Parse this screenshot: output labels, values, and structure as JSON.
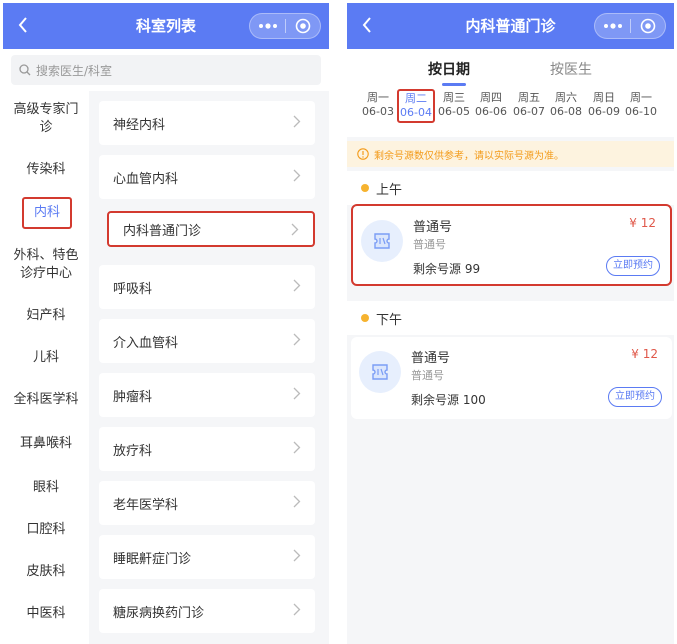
{
  "left": {
    "title": "科室列表",
    "search_placeholder": "搜索医生/科室",
    "departments": [
      {
        "label": "高级专家门诊"
      },
      {
        "label": "传染科"
      },
      {
        "label": "内科"
      },
      {
        "label": "外科、特色诊疗中心"
      },
      {
        "label": "妇产科"
      },
      {
        "label": "儿科"
      },
      {
        "label": "全科医学科"
      },
      {
        "label": "耳鼻喉科"
      },
      {
        "label": "眼科"
      },
      {
        "label": "口腔科"
      },
      {
        "label": "皮肤科"
      },
      {
        "label": "中医科"
      }
    ],
    "active_department": "内科",
    "sub_departments": [
      {
        "label": "神经内科"
      },
      {
        "label": "心血管内科"
      },
      {
        "label": "内科普通门诊"
      },
      {
        "label": "呼吸科"
      },
      {
        "label": "介入血管科"
      },
      {
        "label": "肿瘤科"
      },
      {
        "label": "放疗科"
      },
      {
        "label": "老年医学科"
      },
      {
        "label": "睡眠鼾症门诊"
      },
      {
        "label": "糖尿病换药门诊"
      }
    ]
  },
  "right": {
    "title": "内科普通门诊",
    "tabs": [
      {
        "label": "按日期",
        "active": true
      },
      {
        "label": "按医生",
        "active": false
      }
    ],
    "dates": [
      {
        "weekday": "周一",
        "date": "06-03"
      },
      {
        "weekday": "周二",
        "date": "06-04"
      },
      {
        "weekday": "周三",
        "date": "06-05"
      },
      {
        "weekday": "周四",
        "date": "06-06"
      },
      {
        "weekday": "周五",
        "date": "06-07"
      },
      {
        "weekday": "周六",
        "date": "06-08"
      },
      {
        "weekday": "周日",
        "date": "06-09"
      },
      {
        "weekday": "周一",
        "date": "06-10"
      }
    ],
    "selected_date_index": 1,
    "notice": "剩余号源数仅供参考，请以实际号源为准。",
    "sessions": [
      {
        "label": "上午",
        "slot": {
          "name": "普通号",
          "sub": "普通号",
          "price": "¥ 12",
          "remaining": "剩余号源 99",
          "book": "立即预约"
        }
      },
      {
        "label": "下午",
        "slot": {
          "name": "普通号",
          "sub": "普通号",
          "price": "¥ 12",
          "remaining": "剩余号源 100",
          "book": "立即预约"
        }
      }
    ]
  },
  "colors": {
    "brand": "#5b7bf3",
    "highlight_box": "#d33a2f",
    "price": "#e0584a",
    "notice_text": "#f39b1a",
    "notice_bg": "#fdf3df"
  },
  "icons": [
    "back-arrow-icon",
    "more-dots-icon",
    "target-close-icon",
    "search-icon",
    "chevron-right-icon",
    "info-icon",
    "ticket-icon"
  ]
}
